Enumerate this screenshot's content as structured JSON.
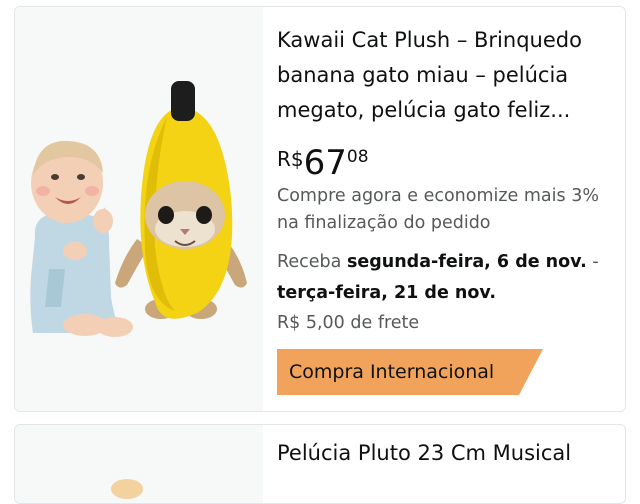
{
  "products": [
    {
      "title": "Kawaii Cat Plush – Brinquedo banana gato miau – pelúcia megato, pelúcia gato feliz...",
      "price": {
        "currency": "R$",
        "whole": "67",
        "fraction": "08"
      },
      "promo": "Compre agora e economize mais 3% na finalização do pedido",
      "delivery": {
        "prefix": "Receba ",
        "start": "segunda-feira, 6 de nov.",
        "separator": " - ",
        "end": "terça-feira, 21 de nov."
      },
      "shipping": "R$ 5,00 de frete",
      "badge": "Compra Internacional"
    },
    {
      "title": "Pelúcia Pluto 23 Cm Musical"
    }
  ],
  "colors": {
    "badge": "#f2a35b",
    "card_border": "#e3e6e6",
    "image_bg": "#f7f8f8",
    "muted_text": "#565959",
    "banana": "#f3d313"
  },
  "icons": [
    "baby-photo",
    "banana-cat-plush-image"
  ]
}
